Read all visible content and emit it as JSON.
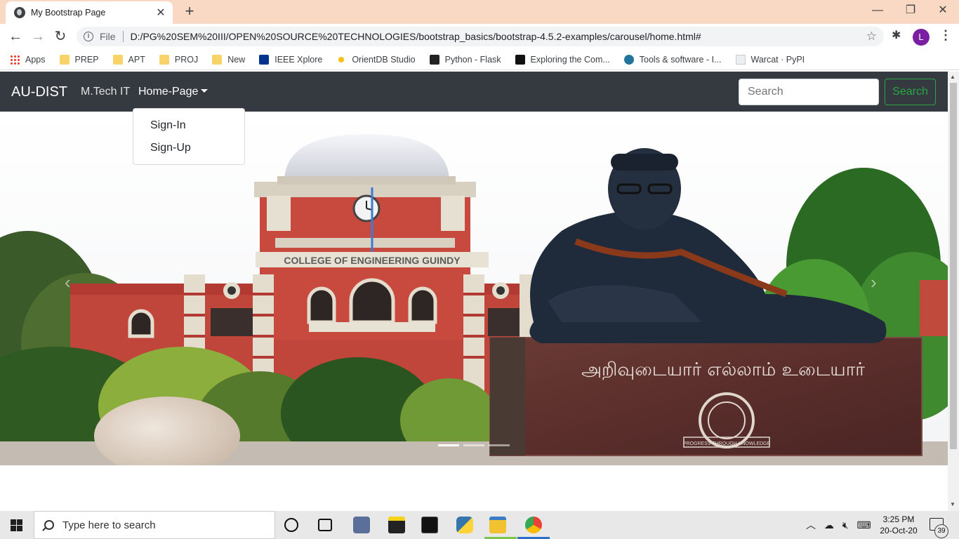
{
  "browser": {
    "tab_title": "My Bootstrap Page",
    "address_prefix": "File",
    "url": "D:/PG%20SEM%20III/OPEN%20SOURCE%20TECHNOLOGIES/bootstrap_basics/bootstrap-4.5.2-examples/carousel/home.html#",
    "profile_initial": "L",
    "bookmarks": [
      {
        "label": "Apps",
        "icon": "apps-grid-icon"
      },
      {
        "label": "PREP",
        "icon": "folder-icon"
      },
      {
        "label": "APT",
        "icon": "folder-icon"
      },
      {
        "label": "PROJ",
        "icon": "folder-icon"
      },
      {
        "label": "New",
        "icon": "folder-icon"
      },
      {
        "label": "IEEE Xplore",
        "icon": "ieee-icon"
      },
      {
        "label": "OrientDB Studio",
        "icon": "orientdb-icon"
      },
      {
        "label": "Python - Flask",
        "icon": "terminal-icon"
      },
      {
        "label": "Exploring the Com...",
        "icon": "hh-icon"
      },
      {
        "label": "Tools & software - I...",
        "icon": "wordpress-icon"
      },
      {
        "label": "Warcat · PyPI",
        "icon": "page-icon"
      }
    ]
  },
  "navbar": {
    "brand": "AU-DIST",
    "link_mtech": "M.Tech IT",
    "link_home": "Home-Page",
    "search_placeholder": "Search",
    "search_button": "Search",
    "dropdown": [
      "Sign-In",
      "Sign-Up"
    ]
  },
  "carousel": {
    "building_sign": "COLLEGE OF ENGINEERING GUINDY",
    "pedestal_text": "அறிவுடையார் எல்லாம் உடையார்",
    "emblem_text": "PROGRESS THROUGH KNOWLEDGE",
    "indicators": 3,
    "active_indicator": 0
  },
  "taskbar": {
    "search_placeholder": "Type here to search",
    "time": "3:25 PM",
    "date": "20-Oct-20",
    "notification_count": "39"
  },
  "colors": {
    "navbar": "#343a40",
    "success": "#28a745",
    "tabstrip": "#f9d9c4"
  }
}
